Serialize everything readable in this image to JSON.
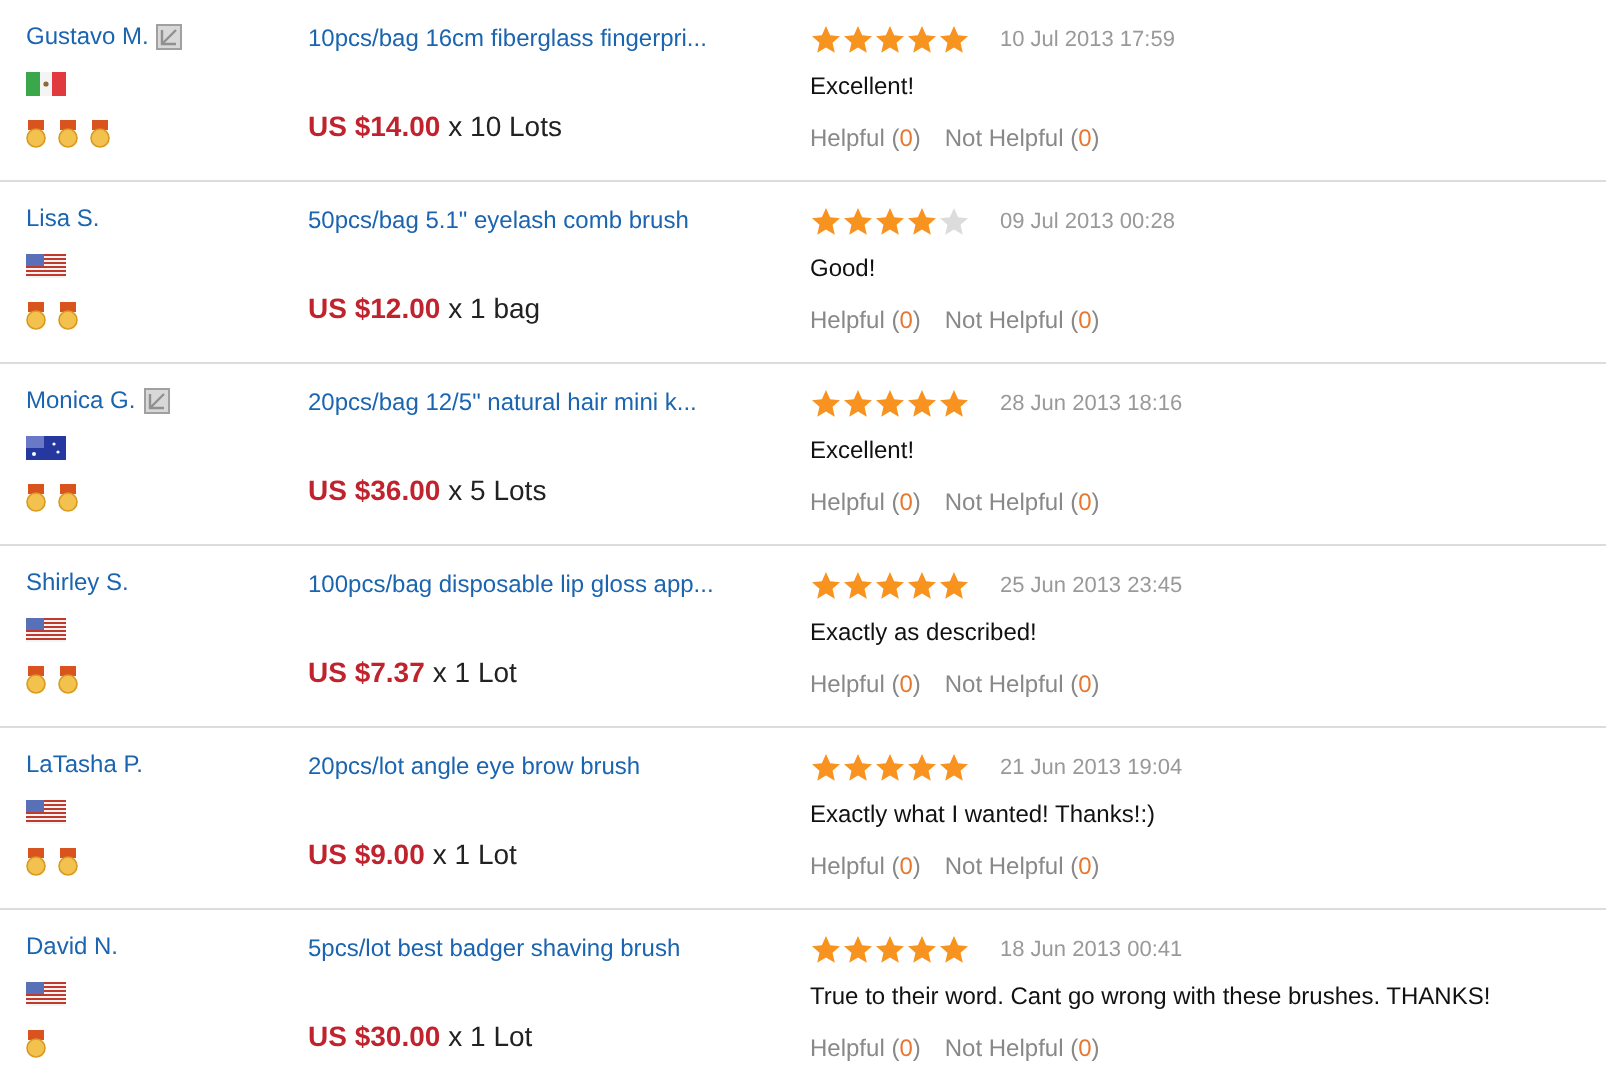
{
  "reviews": [
    {
      "name": "Gustavo M.",
      "note_icon": true,
      "flag": {
        "kind": "mx"
      },
      "medals": [
        {
          "kind": "medal"
        },
        {
          "kind": "medal"
        },
        {
          "kind": "medal"
        }
      ],
      "product": "10pcs/bag 16cm fiberglass fingerpri...",
      "price": "US $14.00",
      "quantity": "x 10 Lots",
      "stars": 5,
      "date": "10 Jul 2013 17:59",
      "comment": "Excellent!",
      "helpful_label": "Helpful (",
      "helpful_count": "0",
      "not_helpful_label": "Not Helpful (",
      "not_helpful_count": "0",
      "close": ")"
    },
    {
      "name": "Lisa S.",
      "note_icon": false,
      "flag": {
        "kind": "us"
      },
      "medals": [
        {
          "kind": "medal"
        },
        {
          "kind": "medal"
        }
      ],
      "product": "50pcs/bag 5.1\" eyelash comb brush",
      "price": "US $12.00",
      "quantity": "x 1 bag",
      "stars": 4,
      "date": "09 Jul 2013 00:28",
      "comment": "Good!",
      "helpful_label": "Helpful (",
      "helpful_count": "0",
      "not_helpful_label": "Not Helpful (",
      "not_helpful_count": "0",
      "close": ")"
    },
    {
      "name": "Monica G.",
      "note_icon": true,
      "flag": {
        "kind": "au"
      },
      "medals": [
        {
          "kind": "medal"
        },
        {
          "kind": "medal"
        }
      ],
      "product": "20pcs/bag 12/5\" natural hair mini k...",
      "price": "US $36.00",
      "quantity": "x 5 Lots",
      "stars": 5,
      "date": "28 Jun 2013 18:16",
      "comment": "Excellent!",
      "helpful_label": "Helpful (",
      "helpful_count": "0",
      "not_helpful_label": "Not Helpful (",
      "not_helpful_count": "0",
      "close": ")"
    },
    {
      "name": "Shirley S.",
      "note_icon": false,
      "flag": {
        "kind": "us"
      },
      "medals": [
        {
          "kind": "medal"
        },
        {
          "kind": "medal"
        }
      ],
      "product": "100pcs/bag disposable lip gloss app...",
      "price": "US $7.37",
      "quantity": "x 1 Lot",
      "stars": 5,
      "date": "25 Jun 2013 23:45",
      "comment": "Exactly as described!",
      "helpful_label": "Helpful (",
      "helpful_count": "0",
      "not_helpful_label": "Not Helpful (",
      "not_helpful_count": "0",
      "close": ")"
    },
    {
      "name": "LaTasha P.",
      "note_icon": false,
      "flag": {
        "kind": "us"
      },
      "medals": [
        {
          "kind": "medal"
        },
        {
          "kind": "medal"
        }
      ],
      "product": "20pcs/lot angle eye brow brush",
      "price": "US $9.00",
      "quantity": "x 1 Lot",
      "stars": 5,
      "date": "21 Jun 2013 19:04",
      "comment": "Exactly what I wanted! Thanks!:)",
      "helpful_label": "Helpful (",
      "helpful_count": "0",
      "not_helpful_label": "Not Helpful (",
      "not_helpful_count": "0",
      "close": ")"
    },
    {
      "name": "David N.",
      "note_icon": false,
      "flag": {
        "kind": "us"
      },
      "medals": [
        {
          "kind": "medal"
        }
      ],
      "product": "5pcs/lot best badger shaving brush",
      "price": "US $30.00",
      "quantity": "x 1 Lot",
      "stars": 5,
      "date": "18 Jun 2013 00:41",
      "comment": "True to their word. Cant go wrong with these brushes. THANKS!",
      "helpful_label": "Helpful (",
      "helpful_count": "0",
      "not_helpful_label": "Not Helpful (",
      "not_helpful_count": "0",
      "close": ")"
    }
  ]
}
